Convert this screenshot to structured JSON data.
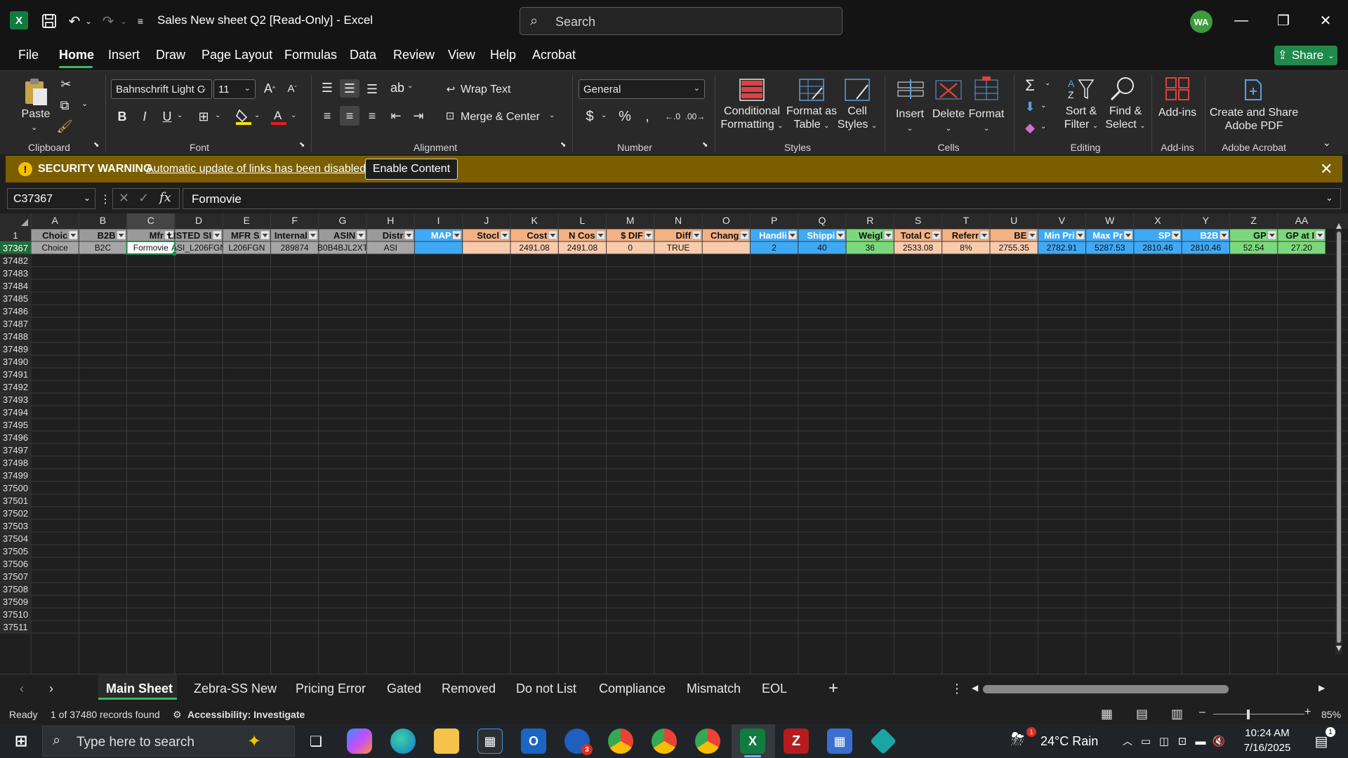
{
  "title_bar": {
    "doc_title": "Sales New sheet Q2  [Read-Only]  -  Excel",
    "search_placeholder": "Search",
    "avatar_initials": "WA"
  },
  "menu": {
    "tabs": [
      "File",
      "Home",
      "Insert",
      "Draw",
      "Page Layout",
      "Formulas",
      "Data",
      "Review",
      "View",
      "Help",
      "Acrobat"
    ],
    "active": "Home",
    "share_label": "Share"
  },
  "ribbon": {
    "clipboard": {
      "paste": "Paste",
      "label": "Clipboard"
    },
    "font": {
      "name": "Bahnschrift Light C",
      "size": "11",
      "label": "Font"
    },
    "alignment": {
      "wrap_text": "Wrap Text",
      "merge_center": "Merge & Center",
      "label": "Alignment"
    },
    "number": {
      "format": "General",
      "label": "Number"
    },
    "styles": {
      "conditional_1": "Conditional",
      "conditional_2": "Formatting",
      "format_table_1": "Format as",
      "format_table_2": "Table",
      "cell_styles_1": "Cell",
      "cell_styles_2": "Styles",
      "label": "Styles"
    },
    "cells": {
      "insert": "Insert",
      "delete": "Delete",
      "format": "Format",
      "label": "Cells"
    },
    "editing": {
      "sort_1": "Sort &",
      "sort_2": "Filter",
      "find_1": "Find &",
      "find_2": "Select",
      "label": "Editing"
    },
    "addins": {
      "button": "Add-ins",
      "label": "Add-ins"
    },
    "acrobat": {
      "button_1": "Create and Share",
      "button_2": "Adobe PDF",
      "label": "Adobe Acrobat"
    }
  },
  "security_bar": {
    "title": "SECURITY WARNING",
    "message": "Automatic update of links has been disabled",
    "button": "Enable Content"
  },
  "formula_bar": {
    "name_box": "C37367",
    "formula": "Formovie"
  },
  "grid": {
    "columns": [
      "A",
      "B",
      "C",
      "D",
      "E",
      "F",
      "G",
      "H",
      "I",
      "J",
      "K",
      "L",
      "M",
      "N",
      "O",
      "P",
      "Q",
      "R",
      "S",
      "T",
      "U",
      "V",
      "W",
      "X",
      "Y",
      "Z",
      "AA"
    ],
    "header_row_number": "1",
    "header_cells": [
      "Choic",
      "B2B",
      "Mfr",
      "LISTED SI",
      "MFR S",
      "Internal",
      "ASIN",
      "Distr",
      "MAP",
      "Stocl",
      "Cost",
      "N Cos",
      "$ DIF",
      "Diff",
      "Chang",
      "Handli",
      "Shippi",
      "Weigl",
      "Total C",
      "Referr",
      "BE",
      "Min Pri",
      "Max Pr",
      "SP",
      "B2B",
      "GP",
      "GP at I"
    ],
    "header_colors": [
      "#9a9a9a",
      "#9a9a9a",
      "#9a9a9a",
      "#9a9a9a",
      "#9a9a9a",
      "#9a9a9a",
      "#9a9a9a",
      "#9a9a9a",
      "#3fa9f5",
      "#f4b183",
      "#f4b183",
      "#f4b183",
      "#f4b183",
      "#f4b183",
      "#f4b183",
      "#3fa9f5",
      "#3fa9f5",
      "#7dd87d",
      "#f4b183",
      "#f4b183",
      "#f4b183",
      "#3fa9f5",
      "#3fa9f5",
      "#3fa9f5",
      "#3fa9f5",
      "#7dd87d",
      "#7dd87d"
    ],
    "data_row_number": "37367",
    "data_cells": [
      "Choice",
      "B2C",
      "Formovie",
      "ASI_L206FGN",
      "L206FGN",
      "289874",
      "B0B4BJL2XT",
      "ASI",
      "",
      "",
      "2491.08",
      "2491.08",
      "0",
      "TRUE",
      "",
      "2",
      "40",
      "36",
      "2533.08",
      "8%",
      "2755.35",
      "2782.91",
      "5287.53",
      "2810.46",
      "2810.46",
      "52.54",
      "27.20"
    ],
    "data_colors": [
      "#a6a6a6",
      "#a6a6a6",
      "#ffffff",
      "#a6a6a6",
      "#a6a6a6",
      "#a6a6a6",
      "#a6a6a6",
      "#a6a6a6",
      "#3fa9f5",
      "#f8cbad",
      "#f8cbad",
      "#f8cbad",
      "#f8cbad",
      "#f8cbad",
      "#f8cbad",
      "#3fa9f5",
      "#3fa9f5",
      "#7dd87d",
      "#f8cbad",
      "#f8cbad",
      "#f8cbad",
      "#3fa9f5",
      "#3fa9f5",
      "#3fa9f5",
      "#3fa9f5",
      "#7dd87d",
      "#7dd87d"
    ],
    "empty_rows": [
      "37482",
      "37483",
      "37484",
      "37485",
      "37486",
      "37487",
      "37488",
      "37489",
      "37490",
      "37491",
      "37492",
      "37493",
      "37494",
      "37495",
      "37496",
      "37497",
      "37498",
      "37499",
      "37500",
      "37501",
      "37502",
      "37503",
      "37504",
      "37505",
      "37506",
      "37507",
      "37508",
      "37509",
      "37510",
      "37511"
    ],
    "filter_column": "C"
  },
  "sheet_tabs": {
    "tabs": [
      "Main Sheet",
      "Zebra-SS New",
      "Pricing Error",
      "Gated",
      "Removed",
      "Do not List",
      "Compliance",
      "Mismatch",
      "EOL"
    ],
    "active": "Main Sheet"
  },
  "status_bar": {
    "ready": "Ready",
    "records": "1 of 37480 records found",
    "accessibility": "Accessibility: Investigate",
    "zoom": "85%"
  },
  "taskbar": {
    "search_placeholder": "Type here to search",
    "weather": "24°C  Rain",
    "time": "10:24 AM",
    "date": "7/16/2025",
    "notification_badge": "3",
    "outlook_badge": "1",
    "notification_count": "1"
  },
  "colors": {
    "excel_green": "#107c41",
    "accent_green": "#3fb767",
    "security_bar": "#7a5e00"
  }
}
